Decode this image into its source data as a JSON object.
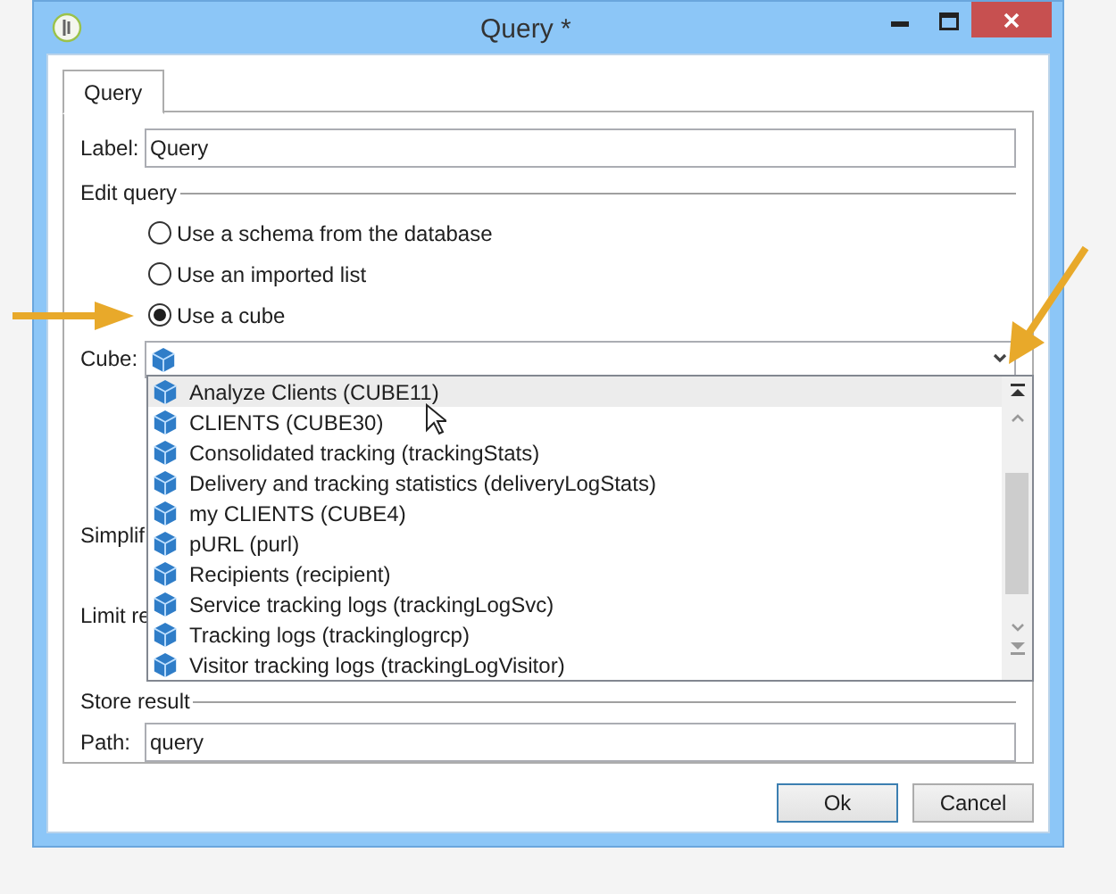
{
  "window": {
    "title": "Query *"
  },
  "tabs": [
    {
      "label": "Query",
      "selected": true
    }
  ],
  "label_field": {
    "label": "Label:",
    "value": "Query"
  },
  "edit_query": {
    "legend": "Edit query",
    "options": [
      {
        "label": "Use a schema from the database",
        "selected": false
      },
      {
        "label": "Use an imported list",
        "selected": false
      },
      {
        "label": "Use a cube",
        "selected": true
      }
    ],
    "cube": {
      "label": "Cube:",
      "expanded": true,
      "items": [
        {
          "label": "Analyze Clients (CUBE11)",
          "selected": true
        },
        {
          "label": "CLIENTS (CUBE30)",
          "selected": false
        },
        {
          "label": "Consolidated tracking (trackingStats)",
          "selected": false
        },
        {
          "label": "Delivery and tracking statistics (deliveryLogStats)",
          "selected": false
        },
        {
          "label": "my CLIENTS (CUBE4)",
          "selected": false
        },
        {
          "label": "pURL (purl)",
          "selected": false
        },
        {
          "label": "Recipients (recipient)",
          "selected": false
        },
        {
          "label": "Service tracking logs (trackingLogSvc)",
          "selected": false
        },
        {
          "label": "Tracking logs (trackinglogrcp)",
          "selected": false
        },
        {
          "label": "Visitor tracking logs (trackingLogVisitor)",
          "selected": false
        }
      ]
    },
    "hidden_labels": [
      "Simplif",
      "Limit re"
    ]
  },
  "store_result": {
    "legend": "Store result",
    "path_label": "Path:",
    "path_value": "query"
  },
  "buttons": [
    {
      "label": "Ok",
      "default": true
    },
    {
      "label": "Cancel",
      "default": false
    }
  ]
}
